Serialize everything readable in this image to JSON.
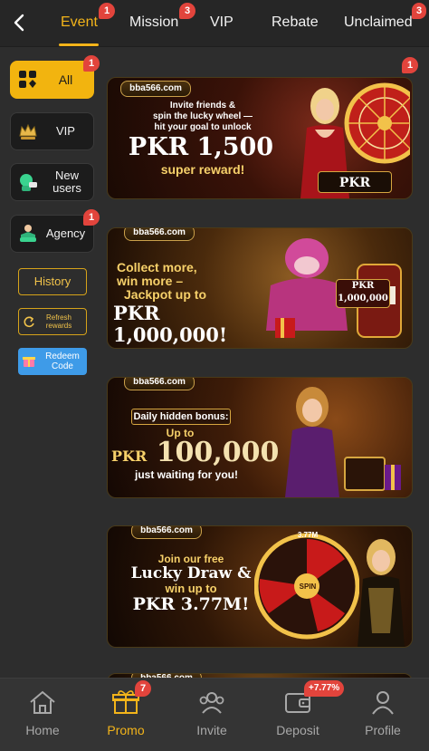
{
  "topbar": {
    "back_icon": "chevron-left-icon",
    "tabs": [
      {
        "label": "Event",
        "badge": "1",
        "active": true
      },
      {
        "label": "Mission",
        "badge": "3"
      },
      {
        "label": "VIP",
        "badge": ""
      },
      {
        "label": "Rebate",
        "badge": ""
      },
      {
        "label": "Unclaimed",
        "badge": "3"
      }
    ]
  },
  "sidebar": {
    "items": [
      {
        "label": "All",
        "badge": "1",
        "icon": "grid-icon",
        "active": true
      },
      {
        "label": "VIP",
        "badge": "",
        "icon": "crown-icon"
      },
      {
        "label": "New users",
        "badge": "",
        "icon": "new-user-icon"
      },
      {
        "label": "Agency",
        "badge": "1",
        "icon": "agency-icon"
      }
    ],
    "history_label": "History",
    "refresh_label": "Refresh rewards",
    "redeem_label": "Redeem Code"
  },
  "banners": [
    {
      "logo": "bba566.com",
      "line1": "Invite friends &",
      "line2": "spin the lucky wheel —",
      "line3": "hit your goal to unlock",
      "amount": "PKR 1,500",
      "tail": "super reward!",
      "tag": "PKR 1,500",
      "badge": "1"
    },
    {
      "logo": "bba566.com",
      "line1": "Collect more,",
      "line2": "win more –",
      "line3": "Jackpot up to",
      "amount": "PKR 1,000,000!",
      "tag_top": "PKR",
      "tag": "1,000,000"
    },
    {
      "logo": "bba566.com",
      "line1": "Daily hidden bonus:",
      "line2": "Up to",
      "currency": "PKR",
      "amount": "100,000",
      "tail": "just waiting for you!"
    },
    {
      "logo": "bba566.com",
      "line1": "Join our free",
      "line2": "Lucky Draw &",
      "line3": "win up to",
      "amount": "PKR 3.77M!",
      "wheel_top": "3.77M",
      "wheel_center": "SPIN"
    },
    {
      "logo": "bba566.com"
    }
  ],
  "bottomnav": {
    "items": [
      {
        "label": "Home",
        "icon": "home-icon"
      },
      {
        "label": "Promo",
        "icon": "gift-icon",
        "badge": "7",
        "active": true
      },
      {
        "label": "Invite",
        "icon": "invite-icon"
      },
      {
        "label": "Deposit",
        "icon": "wallet-icon",
        "badge": "+7.77%"
      },
      {
        "label": "Profile",
        "icon": "profile-icon"
      }
    ]
  },
  "colors": {
    "accent": "#f3b41a",
    "badge": "#e2443c",
    "background": "#2d2d2d"
  }
}
